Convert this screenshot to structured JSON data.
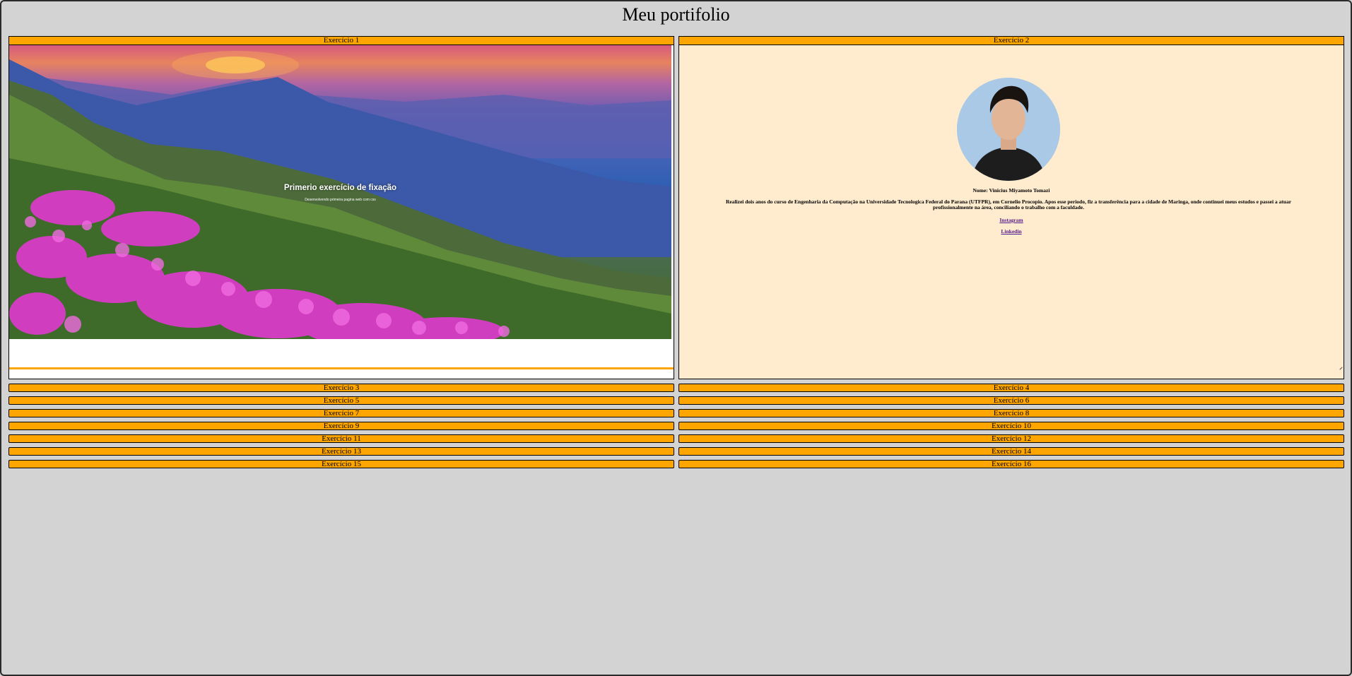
{
  "page": {
    "title": "Meu portifolio"
  },
  "exercises": [
    {
      "label": "Exercício 1",
      "open": true
    },
    {
      "label": "Exercício 2",
      "open": true
    },
    {
      "label": "Exercício 3"
    },
    {
      "label": "Exercício 4"
    },
    {
      "label": "Exercício 5"
    },
    {
      "label": "Exercício 6"
    },
    {
      "label": "Exercício 7"
    },
    {
      "label": "Exercício 8"
    },
    {
      "label": "Exercício 9"
    },
    {
      "label": "Exercício 10"
    },
    {
      "label": "Exercício 11"
    },
    {
      "label": "Exercício 12"
    },
    {
      "label": "Exercício 13"
    },
    {
      "label": "Exercício 14"
    },
    {
      "label": "Exercício 15"
    },
    {
      "label": "Exercício 16"
    }
  ],
  "exercise1": {
    "hero_title": "Primerio exercício de fixação",
    "hero_subtitle": "Desenvolvendo primeira pagina web com css"
  },
  "exercise2": {
    "name": "Nome: Vinicius Miyamoto Tomazi",
    "bio": "Realizei dois anos do curso de Engenharia da Computação na Universidade Tecnologica Federal do Parana (UTFPR), em Cornelio Procopio. Apos esse periodo, fiz a transferência para a cidade de Maringa, onde continuei meus estudos e passei a atuar profissionalmente na área, conciliando o trabalho com a faculdade.",
    "link_instagram": "Instagram",
    "link_linkedin": "Linkedin"
  },
  "colors": {
    "background": "#d3d3d3",
    "header": "#ffa500",
    "card": "#ffebcd",
    "link": "#551a8b"
  }
}
